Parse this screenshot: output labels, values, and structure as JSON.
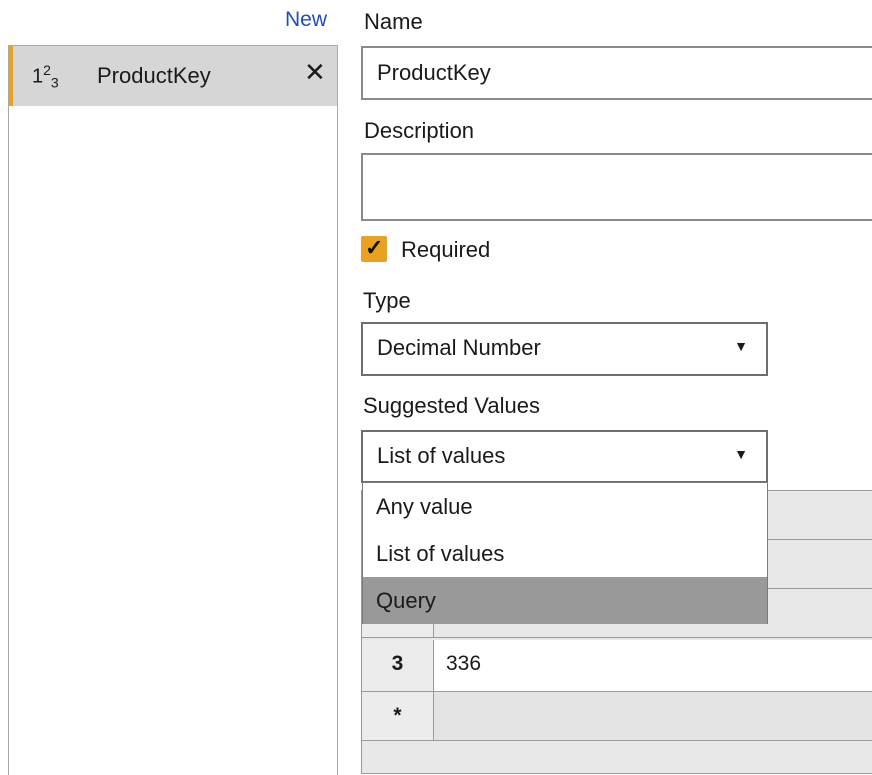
{
  "parameters_panel": {
    "new_label": "New",
    "items": [
      {
        "type_icon_base": "1",
        "type_icon_sup": "2",
        "type_icon_sub": "3",
        "name": "ProductKey",
        "delete_glyph": "✕"
      }
    ]
  },
  "form": {
    "name_label": "Name",
    "name_value": "ProductKey",
    "description_label": "Description",
    "description_value": "",
    "required_label": "Required",
    "required_checked": true,
    "type_label": "Type",
    "type_value": "Decimal Number",
    "suggested_values_label": "Suggested Values",
    "suggested_values_value": "List of values"
  },
  "suggested_values_dropdown": {
    "options": [
      "Any value",
      "List of values",
      "Query"
    ],
    "highlighted": "Query"
  },
  "values_grid": {
    "rows": [
      {
        "index": "3",
        "value": "336"
      },
      {
        "index": "*",
        "value": ""
      }
    ]
  },
  "colors": {
    "accent": "#e8a21f",
    "link": "#1f4fbf",
    "highlight": "#999999"
  }
}
